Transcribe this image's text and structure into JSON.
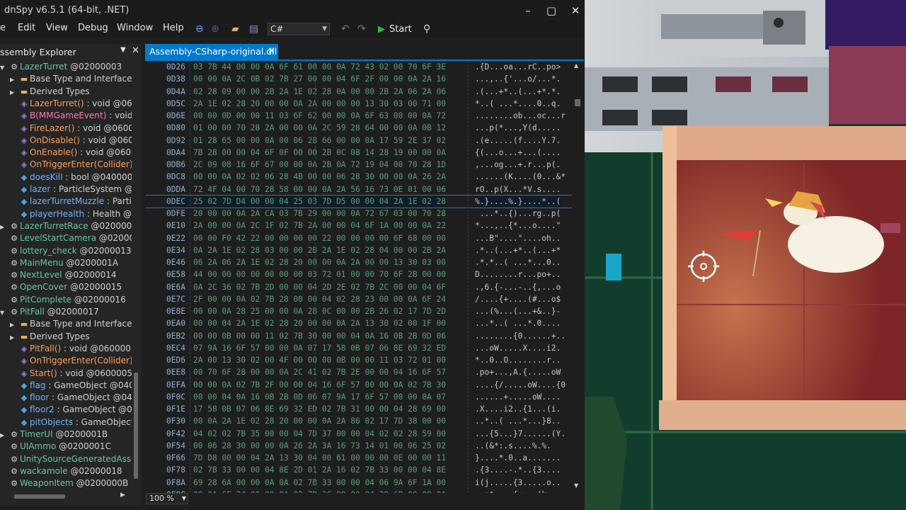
{
  "window": {
    "title": "dnSpy v6.5.1 (64-bit, .NET)",
    "minimize": "–",
    "maximize": "▢",
    "close": "✕"
  },
  "menu": [
    "e",
    "Edit",
    "View",
    "Debug",
    "Window",
    "Help"
  ],
  "toolbar": {
    "language": "C#",
    "start_label": "Start"
  },
  "explorer": {
    "title": "ssembly Explorer",
    "tree": [
      {
        "indent": 0,
        "exp": "open",
        "icon": "class",
        "text": "LazerTurret",
        "suffix": " @02000003",
        "cls": "c-class"
      },
      {
        "indent": 1,
        "exp": "closed",
        "icon": "folder",
        "text": "Base Type and Interfaces",
        "suffix": "",
        "cls": "c-gray"
      },
      {
        "indent": 1,
        "exp": "closed",
        "icon": "folder",
        "text": "Derived Types",
        "suffix": "",
        "cls": "c-gray"
      },
      {
        "indent": 1,
        "exp": "",
        "icon": "method",
        "text": "LazerTurret()",
        "suffix": " : void @0600",
        "cls": "c-method"
      },
      {
        "indent": 1,
        "exp": "",
        "icon": "method",
        "text": "B(MMGameEvent)",
        "suffix": " : void @",
        "cls": "c-event"
      },
      {
        "indent": 1,
        "exp": "",
        "icon": "method",
        "text": "FireLazer()",
        "suffix": " : void @06000",
        "cls": "c-method"
      },
      {
        "indent": 1,
        "exp": "",
        "icon": "method",
        "text": "OnDisable()",
        "suffix": " : void @0600",
        "cls": "c-method"
      },
      {
        "indent": 1,
        "exp": "",
        "icon": "method",
        "text": "OnEnable()",
        "suffix": " : void @06000",
        "cls": "c-method"
      },
      {
        "indent": 1,
        "exp": "",
        "icon": "method",
        "text": "OnTriggerEnter(Collider)",
        "suffix": " :",
        "cls": "c-method"
      },
      {
        "indent": 1,
        "exp": "",
        "icon": "field",
        "text": "doesKill",
        "suffix": " : bool @0400000",
        "cls": "c-field"
      },
      {
        "indent": 1,
        "exp": "",
        "icon": "field",
        "text": "lazer",
        "suffix": " : ParticleSystem @04",
        "cls": "c-field"
      },
      {
        "indent": 1,
        "exp": "",
        "icon": "field",
        "text": "lazerTurretMuzzle",
        "suffix": " : Particle",
        "cls": "c-field"
      },
      {
        "indent": 1,
        "exp": "",
        "icon": "field",
        "text": "playerHealth",
        "suffix": " : Health @04",
        "cls": "c-field"
      },
      {
        "indent": 0,
        "exp": "closed",
        "icon": "class",
        "text": "LazerTurretRace",
        "suffix": " @02000004",
        "cls": "c-class"
      },
      {
        "indent": 0,
        "exp": "",
        "icon": "class",
        "text": "LevelStartCamera",
        "suffix": " @0200002",
        "cls": "c-class"
      },
      {
        "indent": 0,
        "exp": "",
        "icon": "class",
        "text": "lottery_check",
        "suffix": " @02000013",
        "cls": "c-class"
      },
      {
        "indent": 0,
        "exp": "",
        "icon": "class",
        "text": "MainMenu",
        "suffix": " @0200001A",
        "cls": "c-class"
      },
      {
        "indent": 0,
        "exp": "",
        "icon": "class",
        "text": "NextLevel",
        "suffix": " @02000014",
        "cls": "c-class"
      },
      {
        "indent": 0,
        "exp": "",
        "icon": "class",
        "text": "OpenCover",
        "suffix": " @02000015",
        "cls": "c-class"
      },
      {
        "indent": 0,
        "exp": "",
        "icon": "class",
        "text": "PitComplete",
        "suffix": " @02000016",
        "cls": "c-class"
      },
      {
        "indent": 0,
        "exp": "open",
        "icon": "class",
        "text": "PitFall",
        "suffix": " @02000017",
        "cls": "c-class"
      },
      {
        "indent": 1,
        "exp": "closed",
        "icon": "folder",
        "text": "Base Type and Interfaces",
        "suffix": "",
        "cls": "c-gray"
      },
      {
        "indent": 1,
        "exp": "closed",
        "icon": "folder",
        "text": "Derived Types",
        "suffix": "",
        "cls": "c-gray"
      },
      {
        "indent": 1,
        "exp": "",
        "icon": "method",
        "text": "PitFall()",
        "suffix": " : void @06000057",
        "cls": "c-method"
      },
      {
        "indent": 1,
        "exp": "",
        "icon": "method",
        "text": "OnTriggerEnter(Collider)",
        "suffix": " :",
        "cls": "c-method"
      },
      {
        "indent": 1,
        "exp": "",
        "icon": "method",
        "text": "Start()",
        "suffix": " : void @06000055",
        "cls": "c-method"
      },
      {
        "indent": 1,
        "exp": "",
        "icon": "field",
        "text": "flag",
        "suffix": " : GameObject @0400",
        "cls": "c-field"
      },
      {
        "indent": 1,
        "exp": "",
        "icon": "field",
        "text": "floor",
        "suffix": " : GameObject @040",
        "cls": "c-field"
      },
      {
        "indent": 1,
        "exp": "",
        "icon": "field",
        "text": "floor2",
        "suffix": " : GameObject @04",
        "cls": "c-field"
      },
      {
        "indent": 1,
        "exp": "",
        "icon": "field",
        "text": "pitObjects",
        "suffix": " : GameObject[]",
        "cls": "c-field"
      },
      {
        "indent": 0,
        "exp": "closed",
        "icon": "class",
        "text": "TimerUI",
        "suffix": " @0200001B",
        "cls": "c-class"
      },
      {
        "indent": 0,
        "exp": "",
        "icon": "class",
        "text": "UIAmmo",
        "suffix": " @0200001C",
        "cls": "c-class"
      },
      {
        "indent": 0,
        "exp": "",
        "icon": "class",
        "text": "UnitySourceGeneratedAssem",
        "suffix": "",
        "cls": "c-class"
      },
      {
        "indent": 0,
        "exp": "",
        "icon": "class",
        "text": "wackamole",
        "suffix": " @02000018",
        "cls": "c-class"
      },
      {
        "indent": 0,
        "exp": "",
        "icon": "class",
        "text": "WeaponItem",
        "suffix": " @0200000B",
        "cls": "c-class"
      }
    ]
  },
  "editor": {
    "tab_label": "Assembly-CSharp-original.dll",
    "zoom": "100 %",
    "selected_row": "0DEC",
    "rows": [
      [
        "0D26",
        "03 7B 44 00 00 0A 6F 61 00 00 0A 72 43 02 00 70 6F 3E",
        ".{D...oa...rC..po>"
      ],
      [
        "0D38",
        "00 00 0A 2C 0B 02 7B 27 00 00 04 6F 2F 00 00 0A 2A 16",
        "...,..{'...o/...*."
      ],
      [
        "0D4A",
        "02 28 09 00 00 2B 2A 1E 02 28 0A 00 00 2B 2A 06 2A 06",
        ".(...+*..(...+*.*."
      ],
      [
        "0D5C",
        "2A 1E 02 28 20 00 00 0A 2A 00 00 00 13 30 03 00 71 00",
        "*..( ...*....0..q."
      ],
      [
        "0D6E",
        "00 00 0D 00 00 11 03 6F 62 00 00 0A 6F 63 00 00 0A 72",
        "........ob...oc...r"
      ],
      [
        "0D80",
        "01 00 00 70 28 2A 00 00 0A 2C 59 28 64 00 00 0A 0B 12",
        "...p(*...,Y(d....."
      ],
      [
        "0D92",
        "01 28 65 00 00 0A 00 06 28 66 00 00 0A 17 59 2E 37 02",
        ".(e.....(f....Y.7."
      ],
      [
        "0DA4",
        "7B 28 00 00 04 6F 0F 00 00 2B 0C 08 14 28 19 00 00 0A",
        "{(...o...+...(...."
      ],
      [
        "0DB6",
        "2C 09 08 16 6F 67 00 00 0A 2B 0A 72 19 04 00 70 28 1D",
        ",...og...+.r...p(."
      ],
      [
        "0DC8",
        "00 00 0A 02 02 06 28 4B 00 00 06 28 30 00 00 0A 26 2A",
        "......(K....(0...&*"
      ],
      [
        "0DDA",
        "72 4F 04 00 70 28 58 00 00 0A 2A 56 16 73 0E 01 00 06",
        "rO..p(X...*V.s...."
      ],
      [
        "0DEC",
        "25 02 7D D4 00 00 04 25 03 7D D5 00 00 04 2A 1E 02 28",
        "%.}....%.}....*..("
      ],
      [
        "0DFE",
        "20 00 00 0A 2A CA 03 7B 29 00 00 0A 72 67 03 00 70 28",
        " ...*..{)...rg..p("
      ],
      [
        "0E10",
        "2A 00 00 0A 2C 1F 02 7B 2A 00 00 04 6F 1A 00 00 0A 22",
        "*...,..{*...o....\""
      ],
      [
        "0E22",
        "00 00 F0 42 22 00 00 00 00 22 00 00 00 00 6F 68 00 00",
        "...B\"....\"....oh.."
      ],
      [
        "0E34",
        "0A 2A 1E 02 28 03 00 00 2B 2A 1E 02 28 04 00 00 2B 2A",
        ".*..(...+*..(...+*"
      ],
      [
        "0E46",
        "06 2A 06 2A 1E 02 28 20 00 00 0A 2A 00 00 13 30 03 00",
        ".*.*..( ...*...0.."
      ],
      [
        "0E58",
        "44 00 00 00 00 00 00 00 03 72 01 00 00 70 6F 2B 00 00",
        "D........r...po+.."
      ],
      [
        "0E6A",
        "0A 2C 36 02 7B 2D 00 00 04 2D 2E 02 7B 2C 00 00 04 6F",
        ".,6.{-...-..{,...o"
      ],
      [
        "0E7C",
        "2F 00 00 0A 02 7B 28 00 00 04 02 28 23 00 00 0A 6F 24",
        "/....{+....(#...o$"
      ],
      [
        "0E8E",
        "00 00 0A 28 25 00 00 0A 28 0C 00 00 2B 26 02 17 7D 2D",
        "...(%...(...+&..}-"
      ],
      [
        "0EA0",
        "00 00 04 2A 1E 02 28 20 00 00 0A 2A 13 30 02 00 1F 00",
        "...*..( ...*.0...."
      ],
      [
        "0EB2",
        "00 00 0B 00 00 11 02 7B 30 00 00 04 0A 16 0B 2B 0D 06",
        "........{0......+.."
      ],
      [
        "0EC4",
        "07 9A 16 6F 57 00 00 0A 07 17 58 0B 07 06 8E 69 32 ED",
        "...oW.....X....i2."
      ],
      [
        "0ED6",
        "2A 00 13 30 02 00 4F 00 00 00 0B 00 00 11 03 72 01 00",
        "*..0..O........r.."
      ],
      [
        "0EE8",
        "00 70 6F 28 00 00 0A 2C 41 02 7B 2E 00 00 04 16 6F 57",
        ".po+...,A.{.....oW"
      ],
      [
        "0EFA",
        "00 00 0A 02 7B 2F 00 00 04 16 6F 57 00 00 0A 02 7B 30",
        "....{/.....oW....{0"
      ],
      [
        "0F0C",
        "00 00 04 0A 16 0B 2B 0D 06 07 9A 17 6F 57 00 00 0A 07",
        "......+.....oW...."
      ],
      [
        "0F1E",
        "17 58 0B 07 06 8E 69 32 ED 02 7B 31 00 00 04 28 69 00",
        ".X....i2..{1...(i."
      ],
      [
        "0F30",
        "00 0A 2A 1E 02 28 20 00 00 0A 2A 86 02 17 7D 38 00 00",
        "..*..( ...*...}8.."
      ],
      [
        "0F42",
        "04 02 02 7B 35 00 00 04 7D 37 00 00 04 02 02 28 59 00",
        "...{5...}7......(Y."
      ],
      [
        "0F54",
        "00 06 28 30 00 00 0A 26 2A 3A 16 73 14 01 00 06 25 02",
        "..(&*:.s....%.%."
      ],
      [
        "0F66",
        "7D D8 00 00 04 2A 13 30 04 00 61 00 00 00 0E 00 00 11",
        "}....*.0..a......."
      ],
      [
        "0F78",
        "02 7B 33 00 00 04 8E 2D 01 2A 16 02 7B 33 00 00 04 8E",
        ".{3....-.*..{3...."
      ],
      [
        "0F8A",
        "69 28 6A 00 00 0A 0A 02 7B 33 00 00 04 06 9A 6F 1A 00",
        "i(j.....{3.....o.."
      ],
      [
        "0F9C",
        "00 0A 6F 24 00 00 0A 02 7B 3C 00 00 04 28 6B 00 00 0A",
        "..o$....{<...(k..."
      ]
    ]
  },
  "game": {
    "crosshair": "crosshair-icon"
  }
}
